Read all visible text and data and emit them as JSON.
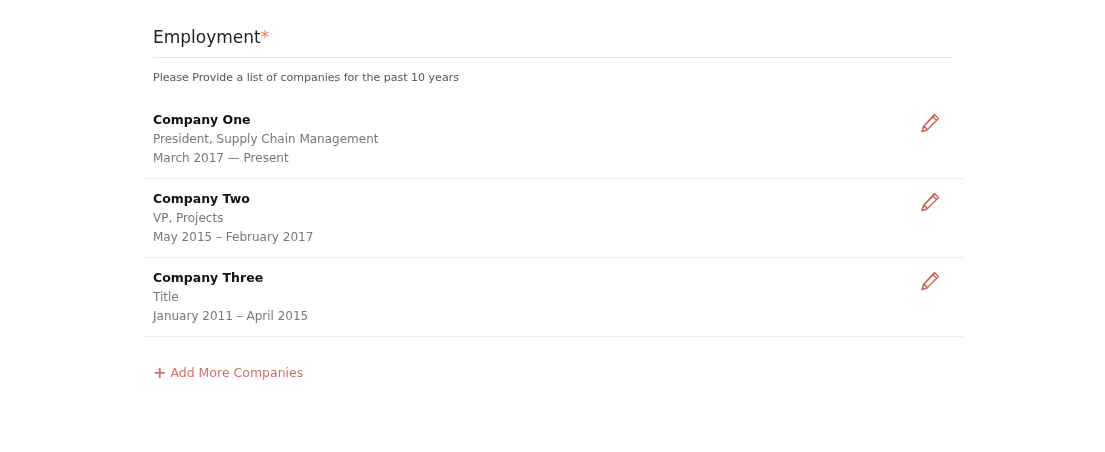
{
  "section": {
    "title": "Employment",
    "required_mark": "*",
    "description": "Please Provide a list of companies for the past 10 years"
  },
  "companies": [
    {
      "name": "Company One",
      "title": "President, Supply Chain Management",
      "dates": "March 2017 — Present"
    },
    {
      "name": "Company Two",
      "title": "VP, Projects",
      "dates": "May 2015 – February 2017"
    },
    {
      "name": "Company Three",
      "title": "Title",
      "dates": "January 2011 – April 2015"
    }
  ],
  "add_link": {
    "icon": "+",
    "label": "Add More Companies"
  }
}
